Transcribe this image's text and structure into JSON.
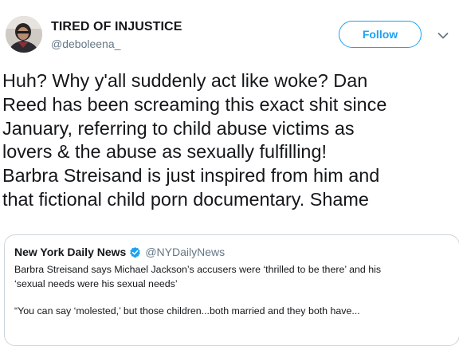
{
  "author": {
    "name": "TIRED OF INJUSTICE",
    "handle": "@deboleena_",
    "avatar_icon": "profile-photo"
  },
  "actions": {
    "follow_label": "Follow",
    "menu_icon": "chevron-down-icon"
  },
  "tweet": {
    "lines": [
      "Huh? Why y'all suddenly act like woke? Dan",
      "Reed has been screaming this exact shit since",
      "January, referring to child abuse victims as",
      "lovers & the abuse as sexually fulfilling!",
      "Barbra Streisand is just inspired from him and",
      "that fictional child porn documentary. Shame"
    ]
  },
  "quoted_tweet": {
    "name": "New York Daily News",
    "handle": "@NYDailyNews",
    "verified_icon": "verified-badge-icon",
    "lines": [
      "Barbra Streisand says Michael Jackson’s accusers were ‘thrilled to be there’ and his",
      "‘sexual needs were his sexual needs’"
    ],
    "excerpt": "“You can say ‘molested,’ but those children...both married and they both have..."
  },
  "colors": {
    "accent": "#1da1f2",
    "text": "#14171a",
    "secondary_text": "#657786",
    "border": "#ccd6dd"
  }
}
